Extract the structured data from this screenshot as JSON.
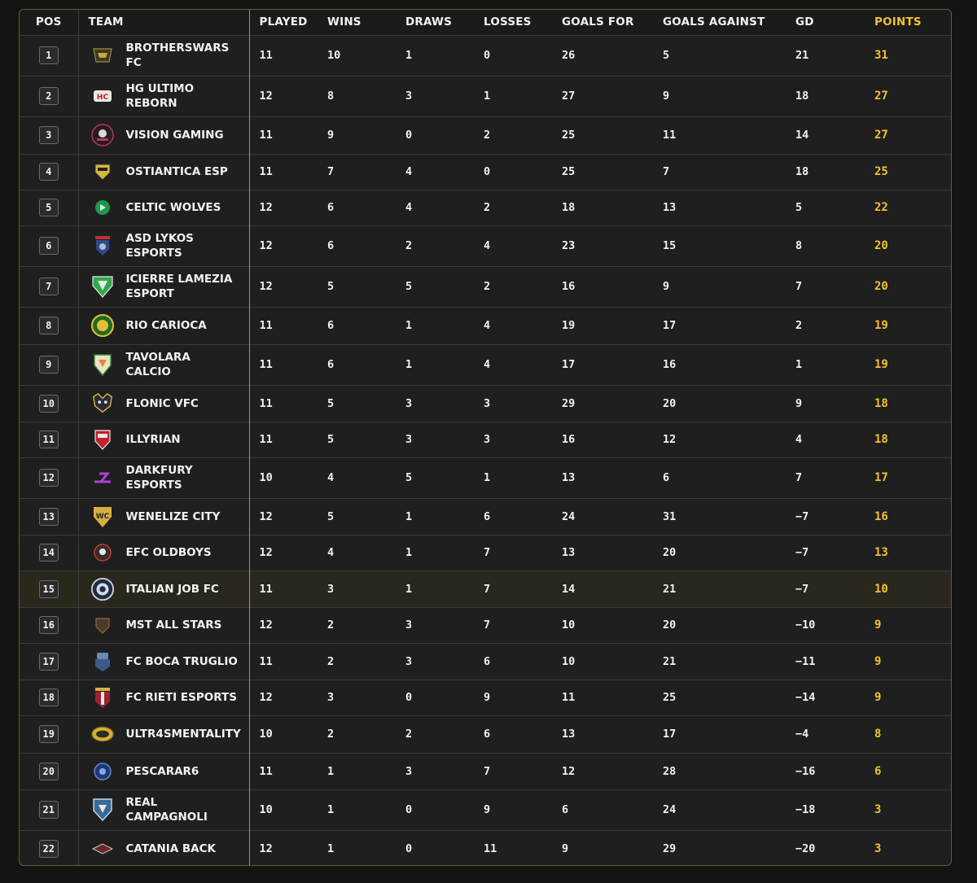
{
  "header": {
    "pos": "POS",
    "team": "TEAM",
    "played": "PLAYED",
    "wins": "WINS",
    "draws": "DRAWS",
    "losses": "LOSSES",
    "goals_for": "GOALS FOR",
    "goals_against": "GOALS AGAINST",
    "gd": "GD",
    "points": "POINTS"
  },
  "colors": {
    "accent_gold": "#f2c230",
    "highlight_row": "#2a271d",
    "background": "#1f1f1f"
  },
  "highlighted_position": "15",
  "rows": [
    {
      "pos": "1",
      "l1": "BROTHERSWARS",
      "l2": "FC",
      "logo": "brotherswars-logo",
      "played": "11",
      "wins": "10",
      "draws": "1",
      "losses": "0",
      "gf": "26",
      "ga": "5",
      "gd": "21",
      "pts": "31"
    },
    {
      "pos": "2",
      "l1": "HG ULTIMO",
      "l2": "REBORN",
      "logo": "hg-ultimo-logo",
      "played": "12",
      "wins": "8",
      "draws": "3",
      "losses": "1",
      "gf": "27",
      "ga": "9",
      "gd": "18",
      "pts": "27"
    },
    {
      "pos": "3",
      "l1": "VISION GAMING",
      "l2": "",
      "logo": "vision-gaming-logo",
      "played": "11",
      "wins": "9",
      "draws": "0",
      "losses": "2",
      "gf": "25",
      "ga": "11",
      "gd": "14",
      "pts": "27"
    },
    {
      "pos": "4",
      "l1": "OSTIANTICA ESP",
      "l2": "",
      "logo": "ostiantica-logo",
      "played": "11",
      "wins": "7",
      "draws": "4",
      "losses": "0",
      "gf": "25",
      "ga": "7",
      "gd": "18",
      "pts": "25"
    },
    {
      "pos": "5",
      "l1": "CELTIC WOLVES",
      "l2": "",
      "logo": "celtic-wolves-logo",
      "played": "12",
      "wins": "6",
      "draws": "4",
      "losses": "2",
      "gf": "18",
      "ga": "13",
      "gd": "5",
      "pts": "22"
    },
    {
      "pos": "6",
      "l1": "ASD LYKOS",
      "l2": "ESPORTS",
      "logo": "asd-lykos-logo",
      "played": "12",
      "wins": "6",
      "draws": "2",
      "losses": "4",
      "gf": "23",
      "ga": "15",
      "gd": "8",
      "pts": "20"
    },
    {
      "pos": "7",
      "l1": "ICIERRE LAMEZIA",
      "l2": "ESPORT",
      "logo": "icierre-lamezia-logo",
      "played": "12",
      "wins": "5",
      "draws": "5",
      "losses": "2",
      "gf": "16",
      "ga": "9",
      "gd": "7",
      "pts": "20"
    },
    {
      "pos": "8",
      "l1": "RIO CARIOCA",
      "l2": "",
      "logo": "rio-carioca-logo",
      "played": "11",
      "wins": "6",
      "draws": "1",
      "losses": "4",
      "gf": "19",
      "ga": "17",
      "gd": "2",
      "pts": "19"
    },
    {
      "pos": "9",
      "l1": "TAVOLARA",
      "l2": "CALCIO",
      "logo": "tavolara-logo",
      "played": "11",
      "wins": "6",
      "draws": "1",
      "losses": "4",
      "gf": "17",
      "ga": "16",
      "gd": "1",
      "pts": "19"
    },
    {
      "pos": "10",
      "l1": "FLONIC VFC",
      "l2": "",
      "logo": "flonic-vfc-logo",
      "played": "11",
      "wins": "5",
      "draws": "3",
      "losses": "3",
      "gf": "29",
      "ga": "20",
      "gd": "9",
      "pts": "18"
    },
    {
      "pos": "11",
      "l1": "ILLYRIAN",
      "l2": "",
      "logo": "illyrian-logo",
      "played": "11",
      "wins": "5",
      "draws": "3",
      "losses": "3",
      "gf": "16",
      "ga": "12",
      "gd": "4",
      "pts": "18"
    },
    {
      "pos": "12",
      "l1": "DARKFURY",
      "l2": "ESPORTS",
      "logo": "darkfury-logo",
      "played": "10",
      "wins": "4",
      "draws": "5",
      "losses": "1",
      "gf": "13",
      "ga": "6",
      "gd": "7",
      "pts": "17"
    },
    {
      "pos": "13",
      "l1": "WENELIZE CITY",
      "l2": "",
      "logo": "wenelize-city-logo",
      "played": "12",
      "wins": "5",
      "draws": "1",
      "losses": "6",
      "gf": "24",
      "ga": "31",
      "gd": "−7",
      "pts": "16"
    },
    {
      "pos": "14",
      "l1": "EFC OLDBOYS",
      "l2": "",
      "logo": "efc-oldboys-logo",
      "played": "12",
      "wins": "4",
      "draws": "1",
      "losses": "7",
      "gf": "13",
      "ga": "20",
      "gd": "−7",
      "pts": "13"
    },
    {
      "pos": "15",
      "l1": "ITALIAN JOB FC",
      "l2": "",
      "logo": "italian-job-logo",
      "played": "11",
      "wins": "3",
      "draws": "1",
      "losses": "7",
      "gf": "14",
      "ga": "21",
      "gd": "−7",
      "pts": "10"
    },
    {
      "pos": "16",
      "l1": "MST ALL STARS",
      "l2": "",
      "logo": "mst-all-stars-logo",
      "played": "12",
      "wins": "2",
      "draws": "3",
      "losses": "7",
      "gf": "10",
      "ga": "20",
      "gd": "−10",
      "pts": "9"
    },
    {
      "pos": "17",
      "l1": "FC BOCA TRUGLIO",
      "l2": "",
      "logo": "boca-truglio-logo",
      "played": "11",
      "wins": "2",
      "draws": "3",
      "losses": "6",
      "gf": "10",
      "ga": "21",
      "gd": "−11",
      "pts": "9"
    },
    {
      "pos": "18",
      "l1": "FC RIETI ESPORTS",
      "l2": "",
      "logo": "rieti-esports-logo",
      "played": "12",
      "wins": "3",
      "draws": "0",
      "losses": "9",
      "gf": "11",
      "ga": "25",
      "gd": "−14",
      "pts": "9"
    },
    {
      "pos": "19",
      "l1": "ULTR4SMENTALITY",
      "l2": "",
      "logo": "ultr4smentality-logo",
      "played": "10",
      "wins": "2",
      "draws": "2",
      "losses": "6",
      "gf": "13",
      "ga": "17",
      "gd": "−4",
      "pts": "8"
    },
    {
      "pos": "20",
      "l1": "PESCARAR6",
      "l2": "",
      "logo": "pescarar6-logo",
      "played": "11",
      "wins": "1",
      "draws": "3",
      "losses": "7",
      "gf": "12",
      "ga": "28",
      "gd": "−16",
      "pts": "6"
    },
    {
      "pos": "21",
      "l1": "REAL",
      "l2": "CAMPAGNOLI",
      "logo": "real-campagnoli-logo",
      "played": "10",
      "wins": "1",
      "draws": "0",
      "losses": "9",
      "gf": "6",
      "ga": "24",
      "gd": "−18",
      "pts": "3"
    },
    {
      "pos": "22",
      "l1": "CATANIA BACK",
      "l2": "",
      "logo": "catania-back-logo",
      "played": "12",
      "wins": "1",
      "draws": "0",
      "losses": "11",
      "gf": "9",
      "ga": "29",
      "gd": "−20",
      "pts": "3"
    }
  ]
}
